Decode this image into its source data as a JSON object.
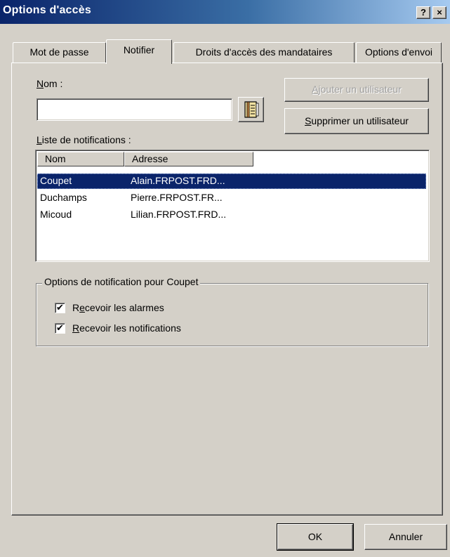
{
  "window": {
    "title": "Options d'accès",
    "help_button": "?",
    "close_button": "×"
  },
  "tabs": [
    {
      "label": "Mot de passe"
    },
    {
      "label": "Notifier"
    },
    {
      "label": "Droits d'accès des mandataires"
    },
    {
      "label": "Options d'envoi"
    }
  ],
  "form": {
    "name_label": "Nom :",
    "name_value": "",
    "add_user_button": "Ajouter un utilisateur",
    "remove_user_button": "Supprimer un utilisateur",
    "address_book_icon": "address-book-icon"
  },
  "list": {
    "label": "Liste de notifications :",
    "columns": [
      "Nom",
      "Adresse"
    ],
    "rows": [
      {
        "name": "Coupet",
        "address": "Alain.FRPOST.FRD..."
      },
      {
        "name": "Duchamps",
        "address": "Pierre.FRPOST.FR..."
      },
      {
        "name": "Micoud",
        "address": "Lilian.FRPOST.FRD..."
      }
    ],
    "selected_index": 0,
    "selection_color": "#0a246a"
  },
  "notification_options": {
    "legend": "Options de notification pour Coupet",
    "receive_alarms": {
      "label": "Recevoir les alarmes",
      "checked": true
    },
    "receive_notifications": {
      "label": "Recevoir les notifications",
      "checked": true
    }
  },
  "footer": {
    "ok_button": "OK",
    "cancel_button": "Annuler"
  }
}
